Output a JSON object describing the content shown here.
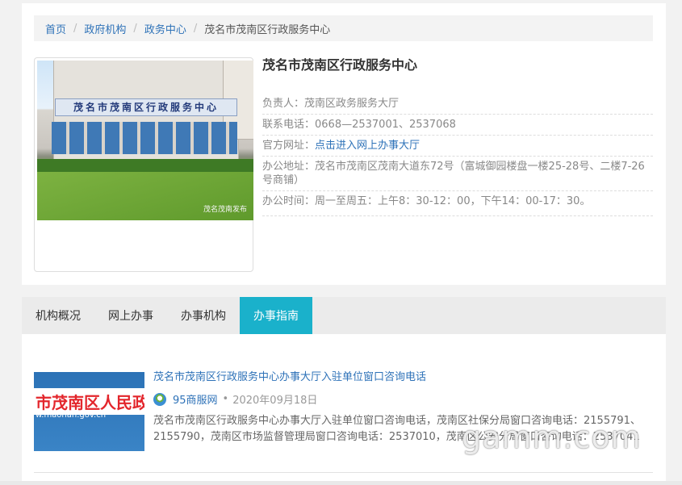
{
  "breadcrumb": {
    "items": [
      "首页",
      "政府机构",
      "政务中心"
    ],
    "current": "茂名市茂南区行政服务中心"
  },
  "photo": {
    "sign_text": "茂名市茂南区行政服务中心",
    "watermark": "茂名茂南发布"
  },
  "org": {
    "name": "茂名市茂南区行政服务中心",
    "leader": "负责人：茂南区政务服务大厅",
    "phone": "联系电话：0668—2537001、2537068",
    "website_label": "官方网址：",
    "website_link": "点击进入网上办事大厅",
    "address": "办公地址：茂名市茂南区茂南大道东72号（富城御园楼盘一楼25-28号、二楼7-26号商铺）",
    "hours": "办公时间：周一至周五：上午8：30-12：00，下午14：00-17：30。"
  },
  "tabs": [
    {
      "label": "机构概况",
      "active": false
    },
    {
      "label": "网上办事",
      "active": false
    },
    {
      "label": "办事机构",
      "active": false
    },
    {
      "label": "办事指南",
      "active": true
    }
  ],
  "articles": [
    {
      "title": "茂名市茂南区行政服务中心办事大厅入驻单位窗口咨询电话",
      "thumb_text": "市茂南区人民政府",
      "thumb_url_text": "w.maonan.gov.cn",
      "source": "95商服网",
      "date": "2020年09月18日",
      "summary": "茂名市茂南区行政服务中心办事大厅入驻单位窗口咨询电话，茂南区社保分局窗口咨询电话：2155791、2155790，茂南区市场监督管理局窗口咨询电话：2537010，茂南区公安分局窗口咨询电话：2537041"
    }
  ],
  "watermark": "gamm.com"
}
